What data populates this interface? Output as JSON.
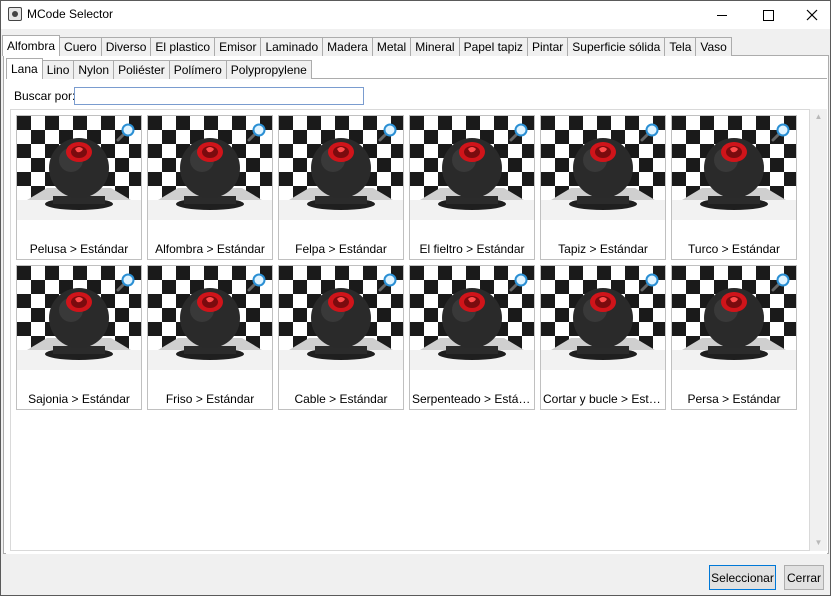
{
  "window": {
    "title": "MCode Selector"
  },
  "categories": [
    "Alfombra",
    "Cuero",
    "Diverso",
    "El plastico",
    "Emisor",
    "Laminado",
    "Madera",
    "Metal",
    "Mineral",
    "Papel tapiz",
    "Pintar",
    "Superficie sólida",
    "Tela",
    "Vaso"
  ],
  "selected_category": "Alfombra",
  "subcategories": [
    "Lana",
    "Lino",
    "Nylon",
    "Poliéster",
    "Polímero",
    "Polypropylene"
  ],
  "selected_subcategory": "Lana",
  "search": {
    "label": "Buscar por:",
    "value": ""
  },
  "materials": [
    "Pelusa > Estándar",
    "Alfombra > Estándar",
    "Felpa > Estándar",
    "El fieltro > Estándar",
    "Tapiz > Estándar",
    "Turco > Estándar",
    "Sajonia > Estándar",
    "Friso > Estándar",
    "Cable > Estándar",
    "Serpenteado > Estándar",
    "Cortar y bucle > Estándar",
    "Persa > Estándar"
  ],
  "icons": {
    "preview": "material-sphere-icon",
    "zoom": "magnifier-icon"
  },
  "buttons": {
    "select": "Seleccionar",
    "cancel": "Cerrar"
  },
  "colors": {
    "accent": "#0078d7",
    "sphere_emblem": "#d0141a"
  }
}
